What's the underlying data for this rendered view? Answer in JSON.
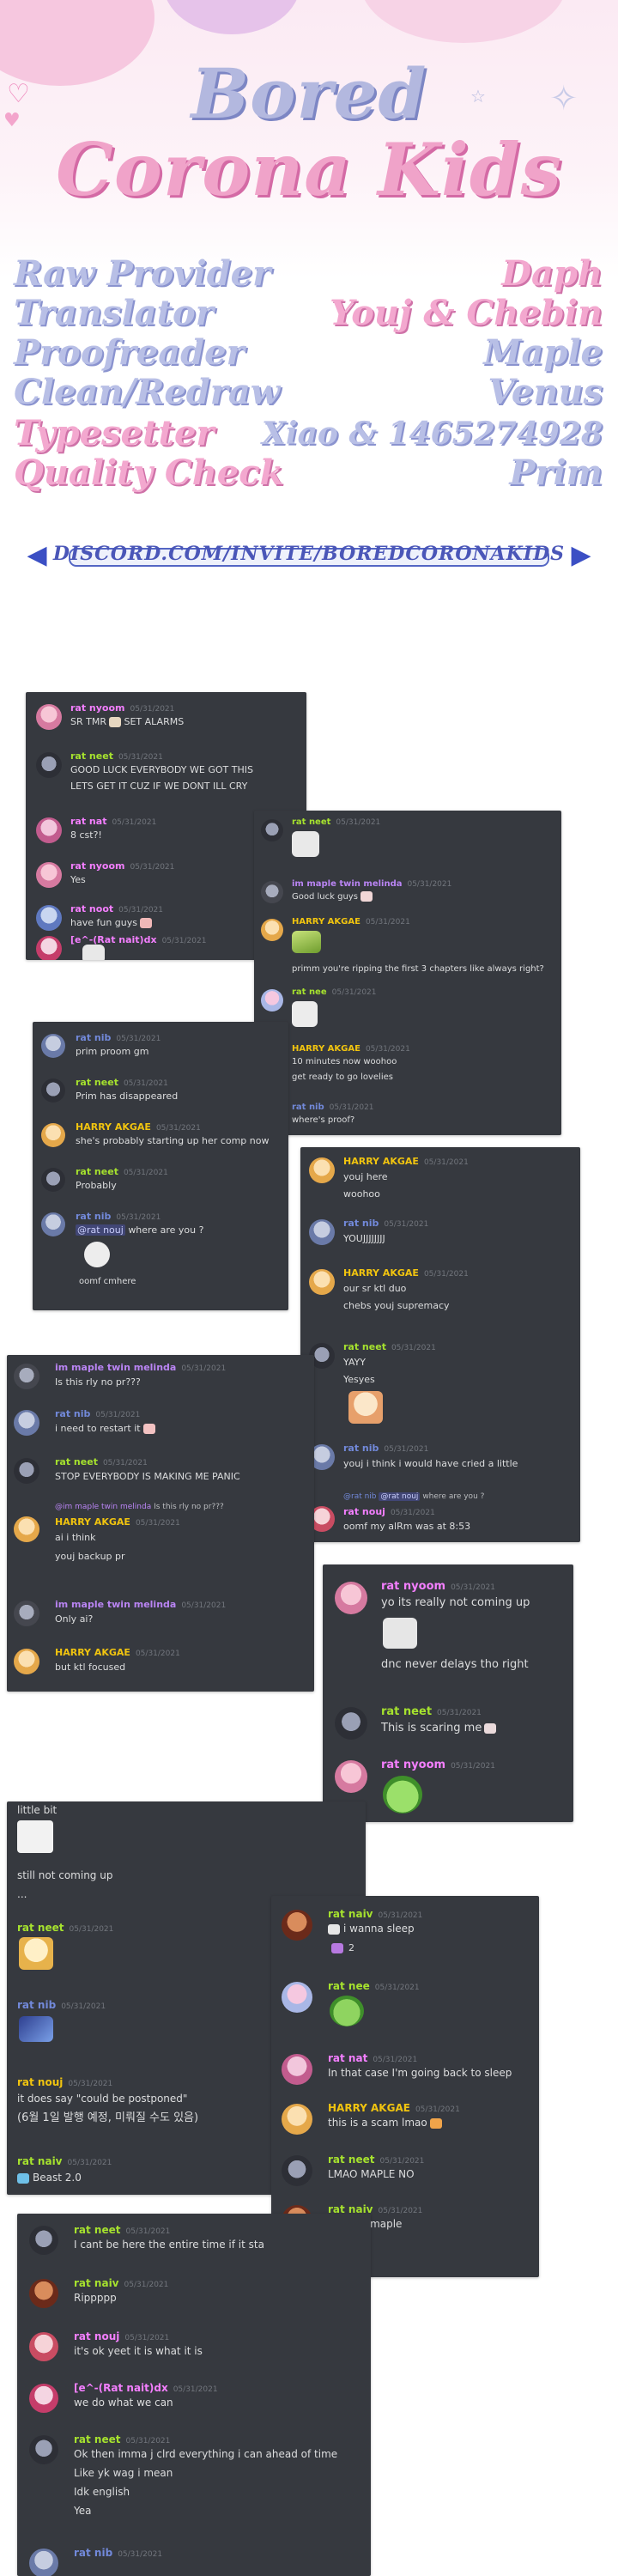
{
  "header": {
    "logo_line1": "Bored",
    "logo_line2": "Corona Kids",
    "credits": [
      {
        "role": "Raw Provider",
        "name": "Daph"
      },
      {
        "role": "Translator",
        "name": "Youj & Chebin"
      },
      {
        "role": "Proofreader",
        "name": "Maple"
      },
      {
        "role": "Clean/Redraw",
        "name": "Venus"
      },
      {
        "role": "Typesetter",
        "name": "Xiao & 1465274928"
      },
      {
        "role": "Quality Check",
        "name": "Prim"
      }
    ],
    "discord_link": "DISCORD.COM/INVITE/BOREDCORONAKIDS"
  },
  "colors": {
    "panel_bg": "#36393f",
    "pink_name": "#f47fff",
    "gold_name": "#f1c40f",
    "green_name": "#a6e22e",
    "blue_name": "#7289da",
    "purple_name": "#b984f3"
  },
  "chat": {
    "p1": [
      {
        "user": "rat nyoom",
        "time": "05/31/2021",
        "text": "SR TMR",
        "text2": "SET ALARMS"
      },
      {
        "user": "rat neet",
        "time": "05/31/2021",
        "text": "GOOD LUCK EVERYBODY WE GOT THIS",
        "text2": "LETS GET IT CUZ IF WE DONT ILL CRY"
      },
      {
        "user": "rat nat",
        "time": "05/31/2021",
        "text": "8 cst?!"
      },
      {
        "user": "rat nyoom",
        "time": "05/31/2021",
        "text": "Yes"
      },
      {
        "user": "rat noot",
        "time": "05/31/2021",
        "text": "have fun guys"
      },
      {
        "user": "[e^-(Rat nait)dx",
        "time": "05/31/2021"
      }
    ],
    "p2": [
      {
        "user": "rat neet",
        "time": "05/31/2021"
      },
      {
        "user": "im maple twin melinda",
        "time": "05/31/2021",
        "text": "Good luck guys"
      },
      {
        "user": "HARRY AKGAE",
        "time": "05/31/2021"
      },
      {
        "user": "",
        "time": "",
        "text": "primm you're ripping the first 3 chapters like always right?"
      },
      {
        "user": "rat nee",
        "time": "05/31/2021"
      },
      {
        "user": "HARRY AKGAE",
        "time": "05/31/2021",
        "text": "10 minutes now woohoo",
        "text2": "get ready to go lovelies"
      },
      {
        "user": "rat nib",
        "time": "05/31/2021",
        "text": "where's proof?"
      }
    ],
    "p3": [
      {
        "user": "rat nib",
        "time": "05/31/2021",
        "text": "prim proom gm"
      },
      {
        "user": "rat neet",
        "time": "05/31/2021",
        "text": "Prim has disappeared"
      },
      {
        "user": "HARRY AKGAE",
        "time": "05/31/2021",
        "text": "she's probably starting up her comp now"
      },
      {
        "user": "rat neet",
        "time": "05/31/2021",
        "text": "Probably"
      },
      {
        "user": "rat nib",
        "time": "05/31/2021",
        "mention": "@rat nouj",
        "text": "where are you ?",
        "text2": "oomf cmhere"
      }
    ],
    "p4": [
      {
        "user": "HARRY AKGAE",
        "time": "05/31/2021",
        "text": "youj here",
        "text2": "woohoo"
      },
      {
        "user": "rat nib",
        "time": "05/31/2021",
        "text": "YOUJJJJJJJJ"
      },
      {
        "user": "HARRY AKGAE",
        "time": "05/31/2021",
        "text": "our sr ktl duo",
        "text2": "chebs youj supremacy"
      },
      {
        "user": "rat neet",
        "time": "05/31/2021",
        "text": "YAYY",
        "text2": "Yesyes"
      },
      {
        "user": "rat nib",
        "time": "05/31/2021",
        "text": "youj i think i would have cried a little"
      },
      {
        "reply_user": "@rat nib",
        "reply_mention": "@rat nouj",
        "reply_text": "where are you ?",
        "user": "rat nouj",
        "time": "05/31/2021",
        "text": "oomf my alRm was at 8:53"
      }
    ],
    "p5": [
      {
        "user": "im maple twin melinda",
        "time": "05/31/2021",
        "text": "Is this rly no pr???"
      },
      {
        "user": "rat nib",
        "time": "05/31/2021",
        "text": "i need to restart it"
      },
      {
        "user": "rat neet",
        "time": "05/31/2021",
        "text": "STOP EVERYBODY IS MAKING ME PANIC"
      },
      {
        "reply_user": "@im maple twin melinda",
        "reply_text": "Is this rly no pr???",
        "user": "HARRY AKGAE",
        "time": "05/31/2021",
        "text": "ai i think",
        "text2": "youj backup pr"
      },
      {
        "user": "im maple twin melinda",
        "time": "05/31/2021",
        "text": "Only ai?"
      },
      {
        "user": "HARRY AKGAE",
        "time": "05/31/2021",
        "text": "but ktl focused"
      }
    ],
    "p6": [
      {
        "user": "rat nyoom",
        "time": "05/31/2021",
        "text": "yo its really not coming up",
        "text2": "dnc never delays tho right"
      },
      {
        "user": "rat neet",
        "time": "05/31/2021",
        "text": "This is scaring me"
      },
      {
        "user": "rat nyoom",
        "time": "05/31/2021"
      }
    ],
    "p7": [
      {
        "user": "",
        "time": "",
        "text": "little bit",
        "text2": "still not coming up",
        "text3": "..."
      },
      {
        "user": "rat neet",
        "time": "05/31/2021"
      },
      {
        "user": "rat nib",
        "time": "05/31/2021"
      },
      {
        "user": "rat nouj",
        "time": "05/31/2021",
        "text": "it does say \"could be postponed\"",
        "text2": "(6월 1일 발행 예정, 미뤄질 수도 있음)"
      },
      {
        "user": "rat naiv",
        "time": "05/31/2021",
        "text": "Beast 2.0"
      }
    ],
    "p8": [
      {
        "user": "rat naiv",
        "time": "05/31/2021",
        "text": "i wanna sleep",
        "text2": "2"
      },
      {
        "user": "rat nee",
        "time": "05/31/2021"
      },
      {
        "user": "rat nat",
        "time": "05/31/2021",
        "text": "In that case I'm going back to sleep"
      },
      {
        "user": "HARRY AKGAE",
        "time": "05/31/2021",
        "text": "this is a scam lmao"
      },
      {
        "user": "rat neet",
        "time": "05/31/2021",
        "text": "LMAO MAPLE NO"
      },
      {
        "user": "rat naiv",
        "time": "05/31/2021",
        "text": "Wait no maple"
      }
    ],
    "p9": [
      {
        "user": "rat neet",
        "time": "05/31/2021",
        "text": "I cant be here the entire time if it sta"
      },
      {
        "user": "rat naiv",
        "time": "05/31/2021",
        "text": "Rippppp"
      },
      {
        "user": "rat nouj",
        "time": "05/31/2021",
        "text": "it's ok yeet it is what it is"
      },
      {
        "user": "[e^-(Rat nait)dx",
        "time": "05/31/2021",
        "text": "we do what we can"
      },
      {
        "user": "rat neet",
        "time": "05/31/2021",
        "text": "Ok then imma j clrd everything i can ahead of time",
        "text2": "Like yk wag i mean",
        "text3": "Idk english",
        "text4": "Yea"
      },
      {
        "user": "rat nib",
        "time": "05/31/2021"
      }
    ]
  }
}
